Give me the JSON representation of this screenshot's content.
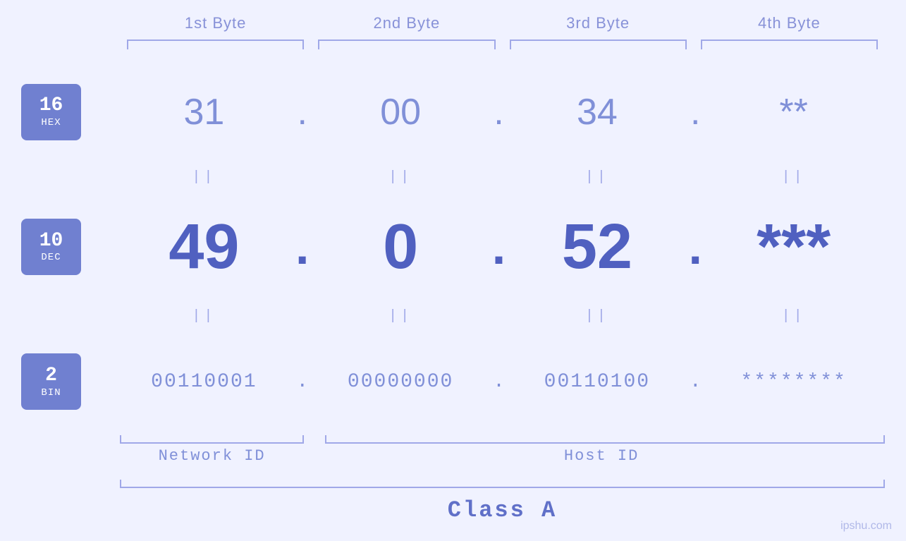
{
  "headers": {
    "byte1": "1st Byte",
    "byte2": "2nd Byte",
    "byte3": "3rd Byte",
    "byte4": "4th Byte"
  },
  "badges": {
    "hex": {
      "num": "16",
      "label": "HEX"
    },
    "dec": {
      "num": "10",
      "label": "DEC"
    },
    "bin": {
      "num": "2",
      "label": "BIN"
    }
  },
  "rows": {
    "hex": {
      "b1": "31",
      "b2": "00",
      "b3": "34",
      "b4": "**",
      "dot": "."
    },
    "dec": {
      "b1": "49",
      "b2": "0",
      "b3": "52",
      "b4": "***",
      "dot": "."
    },
    "bin": {
      "b1": "00110001",
      "b2": "00000000",
      "b3": "00110100",
      "b4": "********",
      "dot": "."
    }
  },
  "separators": {
    "symbol": "||"
  },
  "labels": {
    "network_id": "Network ID",
    "host_id": "Host ID",
    "class": "Class A"
  },
  "watermark": "ipshu.com"
}
